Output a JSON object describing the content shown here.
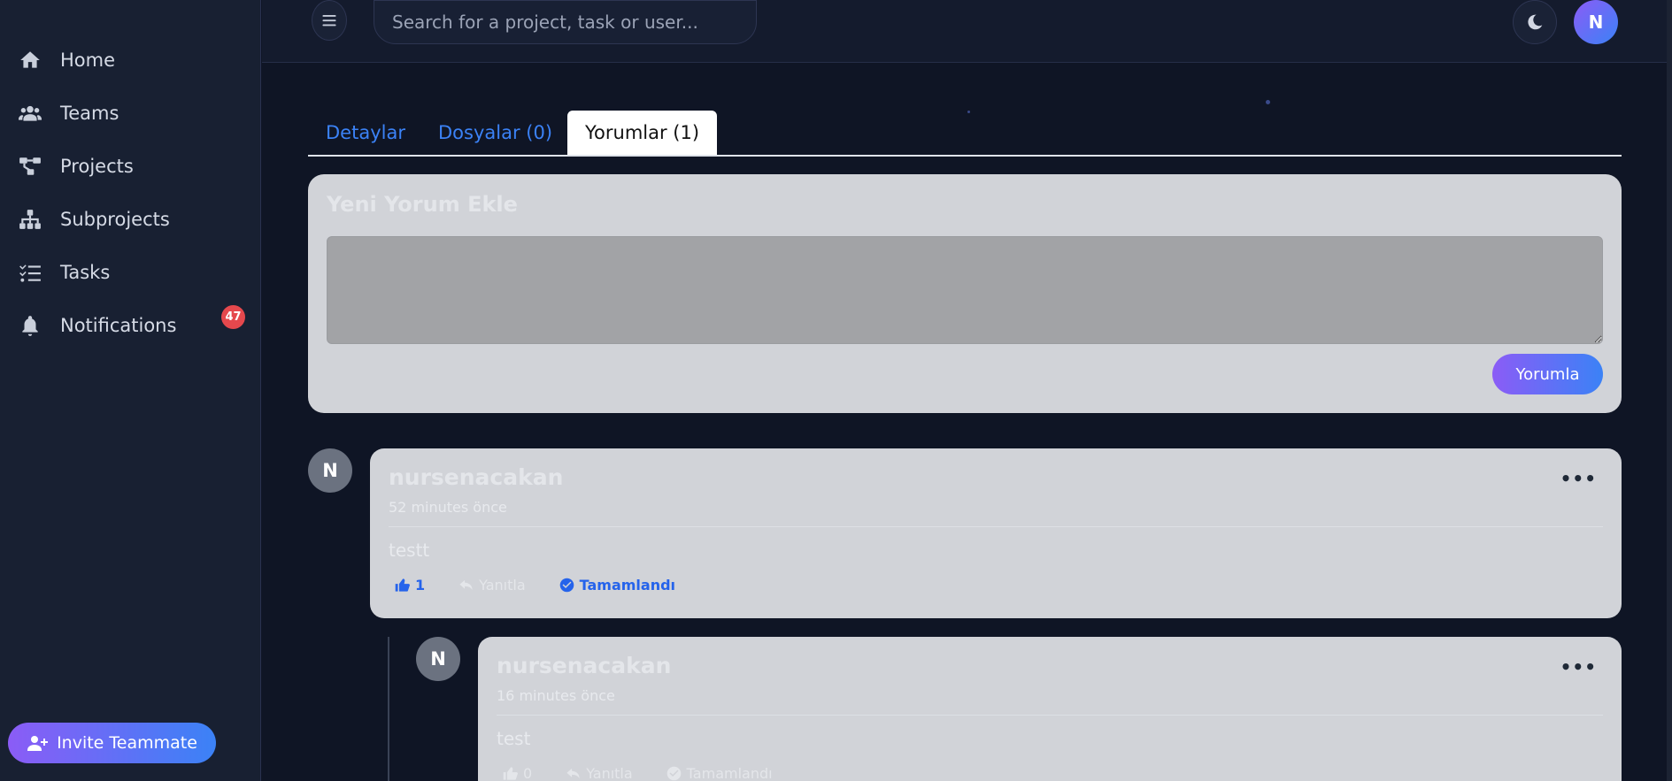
{
  "sidebar": {
    "items": [
      {
        "label": "Home",
        "icon": "home-icon"
      },
      {
        "label": "Teams",
        "icon": "users-icon"
      },
      {
        "label": "Projects",
        "icon": "project-diagram-icon"
      },
      {
        "label": "Subprojects",
        "icon": "sitemap-icon"
      },
      {
        "label": "Tasks",
        "icon": "tasks-icon"
      },
      {
        "label": "Notifications",
        "icon": "bell-icon"
      }
    ],
    "notification_count": "47",
    "invite_label": "Invite Teammate"
  },
  "topbar": {
    "search_placeholder": "Search for a project, task or user...",
    "user_initial": "N"
  },
  "tabs": [
    {
      "label": "Detaylar",
      "active": false
    },
    {
      "label": "Dosyalar (0)",
      "active": false
    },
    {
      "label": "Yorumlar (1)",
      "active": true
    }
  ],
  "new_comment": {
    "title": "Yeni Yorum Ekle",
    "textarea_value": "",
    "submit_label": "Yorumla"
  },
  "comments": [
    {
      "avatar": "N",
      "author": "nursenacakan",
      "time": "52 minutes önce",
      "text": "testt",
      "likes": "1",
      "reply_label": "Yanıtla",
      "status_label": "Tamamlandı"
    },
    {
      "avatar": "N",
      "author": "nursenacakan",
      "time": "16 minutes önce",
      "text": "test",
      "likes": "0",
      "reply_label": "Yanıtla",
      "status_label": "Tamamlandı"
    }
  ],
  "colors": {
    "accent_blue": "#3b82f6",
    "accent_purple": "#8b5cf6",
    "badge_red": "#e5484d",
    "background": "#0f1525",
    "card": "#d1d3d8"
  }
}
